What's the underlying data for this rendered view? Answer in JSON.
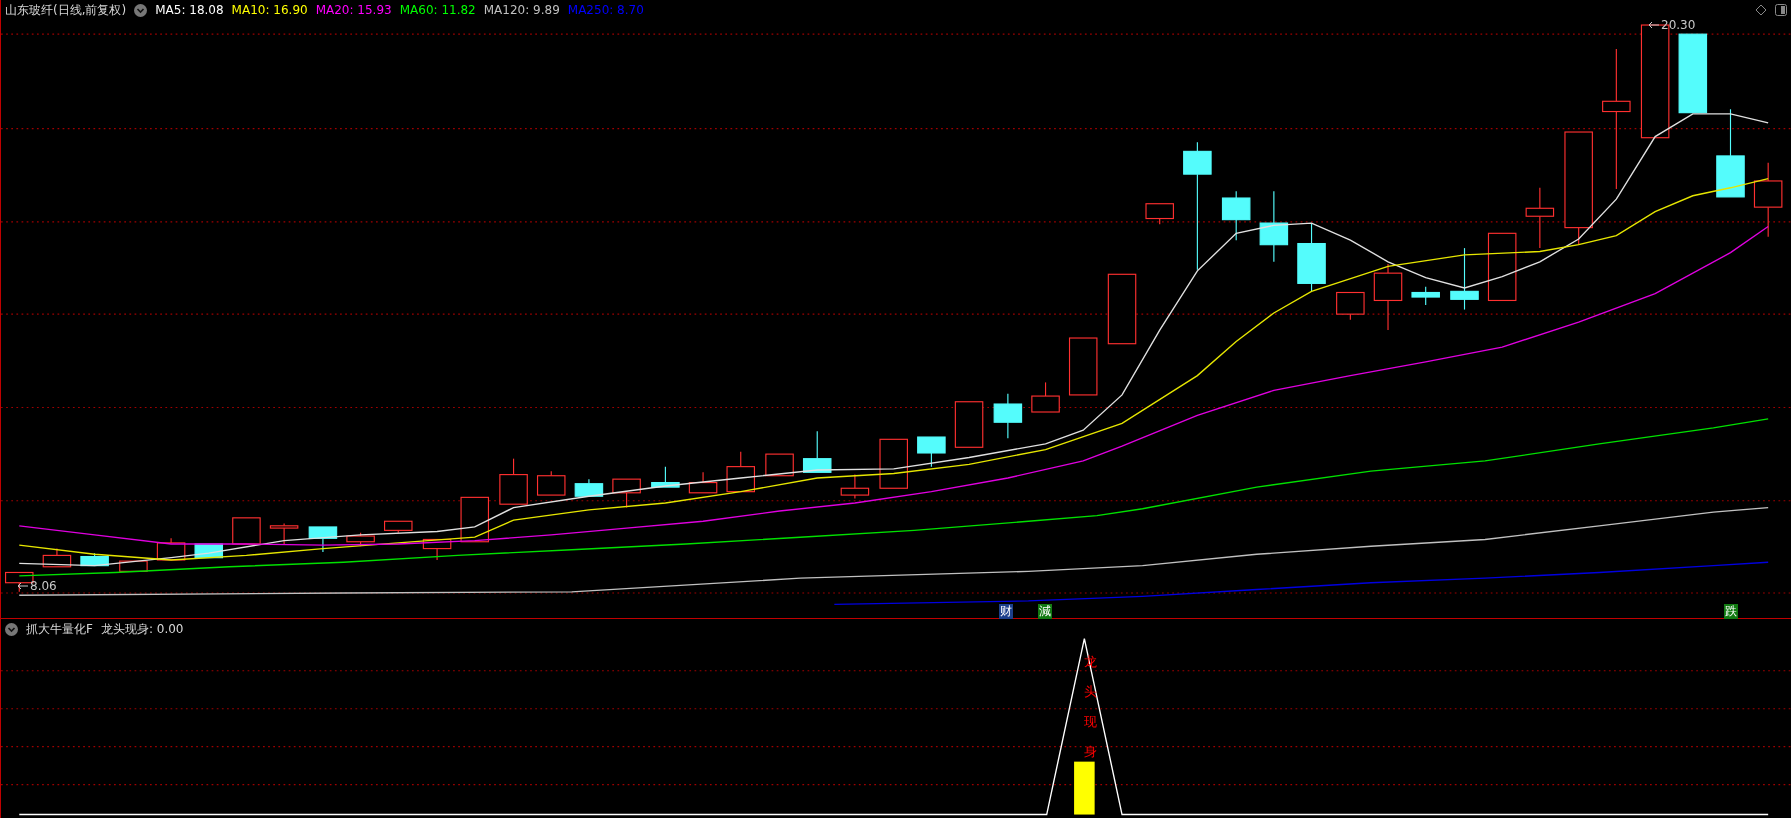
{
  "header": {
    "title": "山东玻纤(日线,前复权)",
    "indicators": [
      {
        "label": "MA5: 18.08",
        "color": "#ffffff"
      },
      {
        "label": "MA10: 16.90",
        "color": "#ffff00"
      },
      {
        "label": "MA20: 15.93",
        "color": "#ff00ff"
      },
      {
        "label": "MA60: 11.82",
        "color": "#00ff00"
      },
      {
        "label": "MA120: 9.89",
        "color": "#c0c0c0"
      },
      {
        "label": "MA250: 8.70",
        "color": "#0000ff"
      }
    ]
  },
  "price_chart": {
    "high_label": "20.30",
    "low_label": "8.06",
    "signals": [
      {
        "text": "财",
        "color": "#1c3f8c"
      },
      {
        "text": "減",
        "color": "#127a12"
      },
      {
        "text": "跌",
        "color": "#127a12"
      }
    ]
  },
  "indicator_panel": {
    "title": "抓大牛量化F",
    "reading": "龙头现身: 0.00",
    "marker_text": "龙头现身"
  }
}
